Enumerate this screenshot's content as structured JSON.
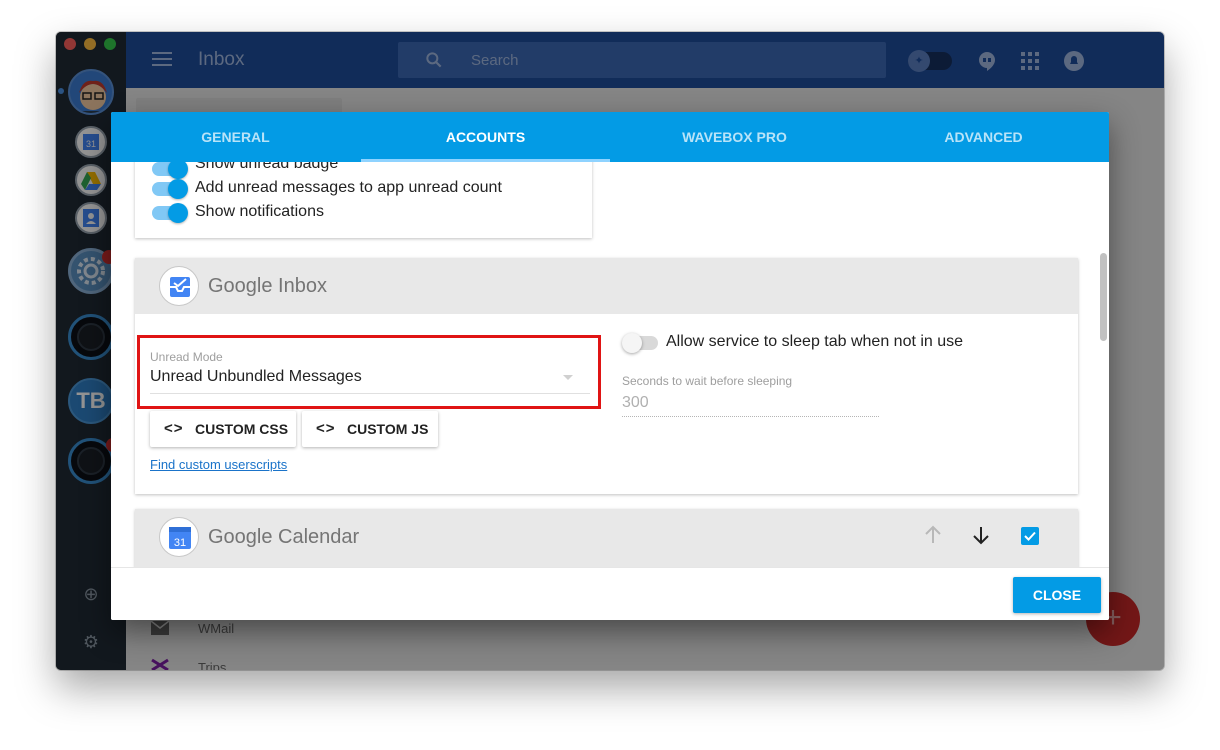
{
  "app": {
    "title": "Inbox",
    "search_placeholder": "Search"
  },
  "sidebar": {
    "items": [
      {
        "name": "profile-avatar",
        "active": true
      },
      {
        "name": "google-calendar",
        "label": "31"
      },
      {
        "name": "google-drive"
      },
      {
        "name": "google-contacts"
      },
      {
        "name": "settings-gear-account",
        "badge": true
      },
      {
        "name": "dark-circle-account"
      },
      {
        "name": "tb-account",
        "label": "TB"
      },
      {
        "name": "dark-circle-account-2",
        "badge": true
      }
    ]
  },
  "background": {
    "list_items": [
      "WMail",
      "Trips"
    ]
  },
  "dialog": {
    "tabs": [
      {
        "label": "GENERAL",
        "active": false
      },
      {
        "label": "ACCOUNTS",
        "active": true
      },
      {
        "label": "WAVEBOX PRO",
        "active": false
      },
      {
        "label": "ADVANCED",
        "active": false
      }
    ],
    "top_card": {
      "toggles": [
        {
          "label": "Show unread badge",
          "on": true
        },
        {
          "label": "Add unread messages to app unread count",
          "on": true
        },
        {
          "label": "Show notifications",
          "on": true
        }
      ]
    },
    "inbox_card": {
      "service_name": "Google Inbox",
      "unread_mode_label": "Unread Mode",
      "unread_mode_value": "Unread Unbundled Messages",
      "custom_css_label": "CUSTOM CSS",
      "custom_js_label": "CUSTOM JS",
      "code_glyph": "<>",
      "find_userscripts_link": "Find custom userscripts",
      "sleep_toggle_label": "Allow service to sleep tab when not in use",
      "sleep_toggle_on": false,
      "sleep_seconds_label": "Seconds to wait before sleeping",
      "sleep_seconds_value": "300"
    },
    "calendar_card": {
      "service_name": "Google Calendar",
      "calendar_day": "31",
      "enabled": true
    },
    "close_label": "CLOSE"
  },
  "colors": {
    "accent": "#039be5",
    "topbar": "#1e4c9a",
    "highlight": "#e01414",
    "fab": "#c62828"
  }
}
